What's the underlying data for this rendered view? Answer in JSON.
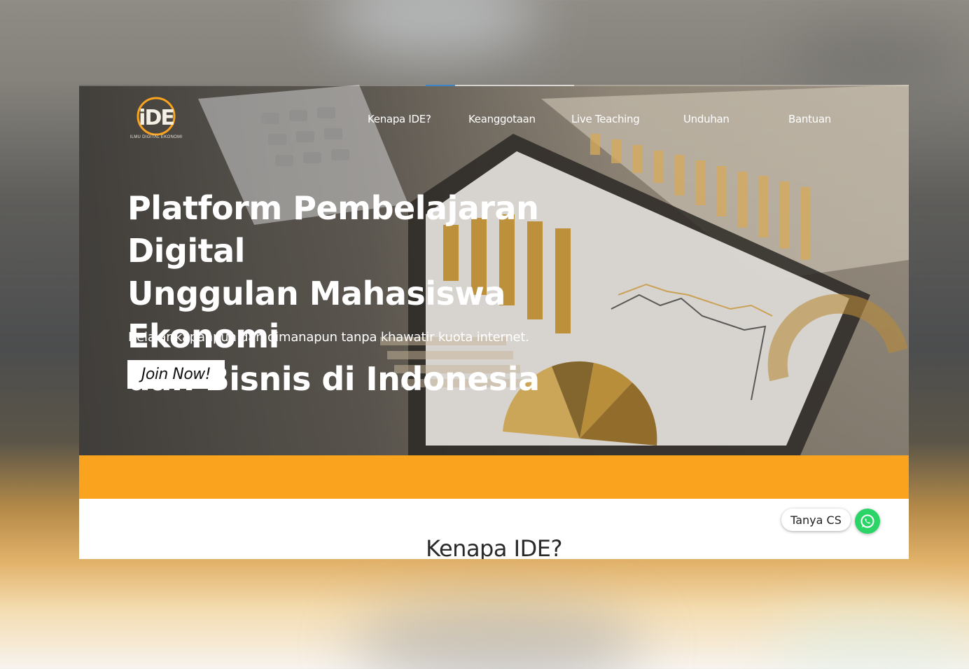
{
  "brand": {
    "logo_text": "iDE",
    "logo_subtitle": "ILMU DIGITAL EKONOMI",
    "accent_color": "#f9a31e"
  },
  "nav": {
    "items": [
      {
        "label": "Kenapa IDE?"
      },
      {
        "label": "Keanggotaan"
      },
      {
        "label": "Live Teaching"
      },
      {
        "label": "Unduhan"
      },
      {
        "label": "Bantuan"
      }
    ]
  },
  "hero": {
    "headline_line1": "Platform Pembelajaran Digital",
    "headline_line2": "Unggulan Mahasiswa Ekonomi",
    "headline_line3": "dan Bisnis di Indonesia",
    "subheadline": "Belajar kapanpun dan dimanapun tanpa khawatir kuota internet.",
    "cta_label": "Join Now!"
  },
  "section": {
    "title": "Kenapa IDE?"
  },
  "chat_widget": {
    "label": "Tanya CS",
    "icon": "whatsapp-icon",
    "color": "#2bd466"
  }
}
